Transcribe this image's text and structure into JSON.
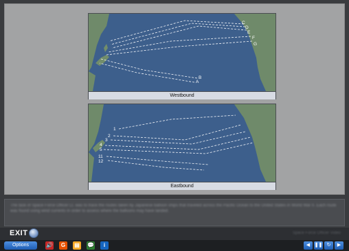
{
  "maps": {
    "westbound": {
      "caption": "Westbound",
      "labels": [
        "C",
        "D",
        "E",
        "F",
        "G",
        "B",
        "A"
      ]
    },
    "eastbound": {
      "caption": "Eastbound",
      "labels": [
        "1",
        "2",
        "3",
        "4",
        "5",
        "11",
        "12"
      ]
    }
  },
  "narration": {
    "text": "The task of Space Force Officer Lt. was to trace the routes taken by Japanese balloon ships that traveled across the Pacific Ocean to the United States in World War II. Each route was found using wind currents in order to assess where the balloons may have landed."
  },
  "exit": {
    "label": "EXIT",
    "right_text": "Space Force Officer   Video"
  },
  "toolbar": {
    "options_label": "Options",
    "icons": [
      {
        "name": "audio-icon",
        "glyph": "🔊",
        "color": "#c62828"
      },
      {
        "name": "glossary-icon",
        "glyph": "G",
        "color": "#e65100"
      },
      {
        "name": "notes-icon",
        "glyph": "▤",
        "color": "#f9a825"
      },
      {
        "name": "comments-icon",
        "glyph": "💬",
        "color": "#2e7d32"
      },
      {
        "name": "info-icon",
        "glyph": "i",
        "color": "#1565c0"
      }
    ],
    "nav": [
      {
        "name": "previous-button",
        "glyph": "◀"
      },
      {
        "name": "pause-button",
        "glyph": "❚❚"
      },
      {
        "name": "replay-button",
        "glyph": "↻"
      },
      {
        "name": "next-button",
        "glyph": "▶"
      }
    ]
  },
  "colors": {
    "ocean": "#3d5f8c",
    "land": "#6f8a6a",
    "route": "#f4f6fa"
  }
}
